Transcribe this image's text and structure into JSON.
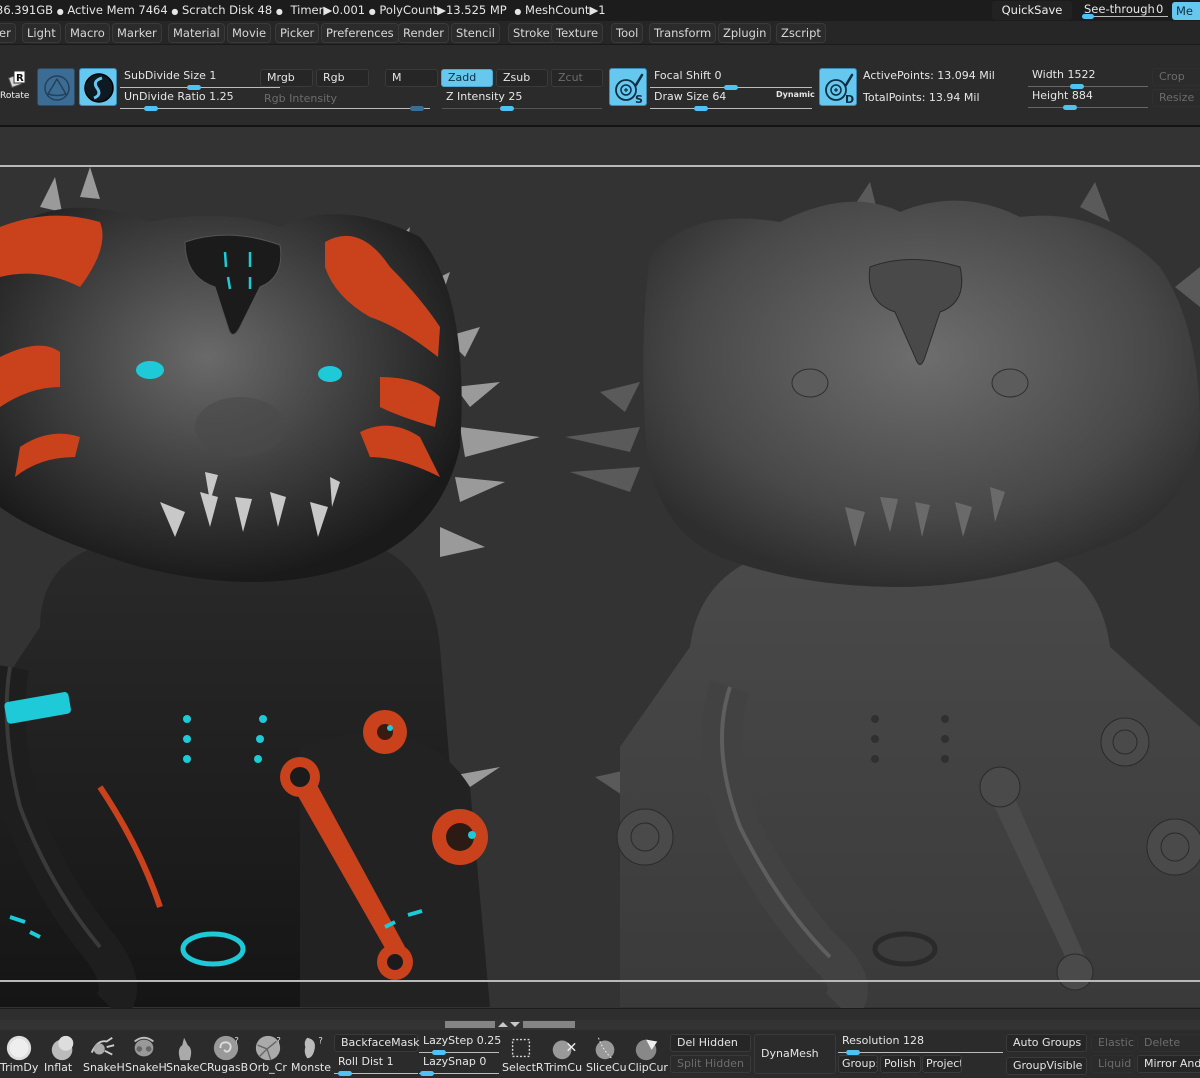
{
  "status": {
    "mem_fragment": "36.391GB",
    "active_mem": "Active Mem 7464",
    "scratch_disk": "Scratch Disk 48",
    "timer": "Timer▶0.001",
    "poly_count": "PolyCount▶13.525 MP",
    "mesh_count": "MeshCount▶1",
    "separator": "●",
    "quicksave": "QuickSave",
    "see_through_label": "See-through",
    "see_through_value": "0",
    "see_through_fraction": 0,
    "menu_button": "Me"
  },
  "menubar": {
    "items": [
      "er",
      "Light",
      "Macro",
      "Marker",
      "Material",
      "Movie",
      "Picker",
      "Preferences",
      "Render",
      "Stencil",
      "Stroke",
      "Texture",
      "Tool",
      "Transform",
      "Zplugin",
      "Zscript"
    ]
  },
  "top_shelf": {
    "rotate_label": "Rotate",
    "subdivide_size": {
      "label": "SubDivide Size",
      "value": "1",
      "fraction": 0.46
    },
    "undivide_ratio": {
      "label": "UnDivide Ratio",
      "value": "1.25",
      "fraction": 0.08
    },
    "mrgb": "Mrgb",
    "rgb": "Rgb",
    "m": "M",
    "rgb_intensity": {
      "label": "Rgb Intensity",
      "fraction": 0.98
    },
    "zadd": "Zadd",
    "zsub": "Zsub",
    "zcut": "Zcut",
    "z_intensity": {
      "label": "Z Intensity",
      "value": "25",
      "fraction": 0.4
    },
    "focal_shift": {
      "label": "Focal Shift",
      "value": "0",
      "fraction": 0.5
    },
    "draw_size": {
      "label": "Draw Size",
      "value": "64",
      "fraction": 0.3
    },
    "dynamic_label": "Dynamic",
    "active_points": "ActivePoints: 13.094 Mil",
    "total_points": "TotalPoints: 13.94 Mil",
    "width": {
      "label": "Width",
      "value": "1522",
      "fraction": 0.4
    },
    "height": {
      "label": "Height",
      "value": "884",
      "fraction": 0.33
    },
    "crop": "Crop",
    "resize": "Resize"
  },
  "viewport": {
    "colors": {
      "background": "#333333",
      "accent_orange": "#c9421c",
      "accent_cyan": "#1ecad8",
      "polypaint_dark": "#1f1f1f",
      "clay_gray": "#5a5a5a"
    }
  },
  "bottom_shelf": {
    "brushes": [
      {
        "label": "TrimDy"
      },
      {
        "label": "Inflat"
      },
      {
        "label": "SnakeH"
      },
      {
        "label": "SnakeH"
      },
      {
        "label": "SnakeC"
      },
      {
        "label": "RugasB"
      },
      {
        "label": "Orb_Cr"
      },
      {
        "label": "Monste"
      }
    ],
    "backface_mask": "BackfaceMask",
    "roll_dist": {
      "label": "Roll Dist",
      "value": "1",
      "fraction": 0.05
    },
    "lazy_step": {
      "label": "LazyStep",
      "value": "0.25",
      "fraction": 0.2
    },
    "lazy_snap": {
      "label": "LazySnap",
      "value": "0",
      "fraction": 0.02
    },
    "tools": [
      {
        "label": "SelectRe"
      },
      {
        "label": "TrimCu"
      },
      {
        "label": "SliceCu"
      },
      {
        "label": "ClipCur"
      }
    ],
    "del_hidden": "Del Hidden",
    "split_hidden": "Split Hidden",
    "dynamesh": "DynaMesh",
    "resolution": {
      "label": "Resolution",
      "value": "128",
      "fraction": 0.05
    },
    "groups": "Group:",
    "polish": "Polish",
    "project": "Project",
    "auto_groups": "Auto Groups",
    "group_visible": "GroupVisible",
    "elastic": "Elastic",
    "liquid": "Liquid",
    "delete": "Delete",
    "mirror_and": "Mirror And"
  }
}
